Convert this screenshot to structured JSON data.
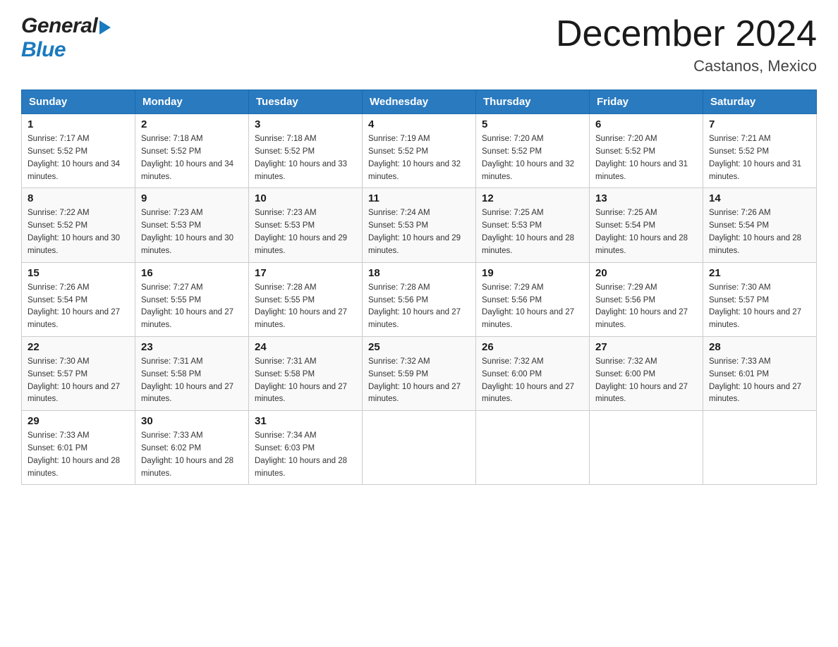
{
  "header": {
    "logo": {
      "general": "General",
      "blue": "Blue"
    },
    "title": "December 2024",
    "location": "Castanos, Mexico"
  },
  "calendar": {
    "days_of_week": [
      "Sunday",
      "Monday",
      "Tuesday",
      "Wednesday",
      "Thursday",
      "Friday",
      "Saturday"
    ],
    "weeks": [
      [
        {
          "day": "1",
          "sunrise": "7:17 AM",
          "sunset": "5:52 PM",
          "daylight": "10 hours and 34 minutes."
        },
        {
          "day": "2",
          "sunrise": "7:18 AM",
          "sunset": "5:52 PM",
          "daylight": "10 hours and 34 minutes."
        },
        {
          "day": "3",
          "sunrise": "7:18 AM",
          "sunset": "5:52 PM",
          "daylight": "10 hours and 33 minutes."
        },
        {
          "day": "4",
          "sunrise": "7:19 AM",
          "sunset": "5:52 PM",
          "daylight": "10 hours and 32 minutes."
        },
        {
          "day": "5",
          "sunrise": "7:20 AM",
          "sunset": "5:52 PM",
          "daylight": "10 hours and 32 minutes."
        },
        {
          "day": "6",
          "sunrise": "7:20 AM",
          "sunset": "5:52 PM",
          "daylight": "10 hours and 31 minutes."
        },
        {
          "day": "7",
          "sunrise": "7:21 AM",
          "sunset": "5:52 PM",
          "daylight": "10 hours and 31 minutes."
        }
      ],
      [
        {
          "day": "8",
          "sunrise": "7:22 AM",
          "sunset": "5:52 PM",
          "daylight": "10 hours and 30 minutes."
        },
        {
          "day": "9",
          "sunrise": "7:23 AM",
          "sunset": "5:53 PM",
          "daylight": "10 hours and 30 minutes."
        },
        {
          "day": "10",
          "sunrise": "7:23 AM",
          "sunset": "5:53 PM",
          "daylight": "10 hours and 29 minutes."
        },
        {
          "day": "11",
          "sunrise": "7:24 AM",
          "sunset": "5:53 PM",
          "daylight": "10 hours and 29 minutes."
        },
        {
          "day": "12",
          "sunrise": "7:25 AM",
          "sunset": "5:53 PM",
          "daylight": "10 hours and 28 minutes."
        },
        {
          "day": "13",
          "sunrise": "7:25 AM",
          "sunset": "5:54 PM",
          "daylight": "10 hours and 28 minutes."
        },
        {
          "day": "14",
          "sunrise": "7:26 AM",
          "sunset": "5:54 PM",
          "daylight": "10 hours and 28 minutes."
        }
      ],
      [
        {
          "day": "15",
          "sunrise": "7:26 AM",
          "sunset": "5:54 PM",
          "daylight": "10 hours and 27 minutes."
        },
        {
          "day": "16",
          "sunrise": "7:27 AM",
          "sunset": "5:55 PM",
          "daylight": "10 hours and 27 minutes."
        },
        {
          "day": "17",
          "sunrise": "7:28 AM",
          "sunset": "5:55 PM",
          "daylight": "10 hours and 27 minutes."
        },
        {
          "day": "18",
          "sunrise": "7:28 AM",
          "sunset": "5:56 PM",
          "daylight": "10 hours and 27 minutes."
        },
        {
          "day": "19",
          "sunrise": "7:29 AM",
          "sunset": "5:56 PM",
          "daylight": "10 hours and 27 minutes."
        },
        {
          "day": "20",
          "sunrise": "7:29 AM",
          "sunset": "5:56 PM",
          "daylight": "10 hours and 27 minutes."
        },
        {
          "day": "21",
          "sunrise": "7:30 AM",
          "sunset": "5:57 PM",
          "daylight": "10 hours and 27 minutes."
        }
      ],
      [
        {
          "day": "22",
          "sunrise": "7:30 AM",
          "sunset": "5:57 PM",
          "daylight": "10 hours and 27 minutes."
        },
        {
          "day": "23",
          "sunrise": "7:31 AM",
          "sunset": "5:58 PM",
          "daylight": "10 hours and 27 minutes."
        },
        {
          "day": "24",
          "sunrise": "7:31 AM",
          "sunset": "5:58 PM",
          "daylight": "10 hours and 27 minutes."
        },
        {
          "day": "25",
          "sunrise": "7:32 AM",
          "sunset": "5:59 PM",
          "daylight": "10 hours and 27 minutes."
        },
        {
          "day": "26",
          "sunrise": "7:32 AM",
          "sunset": "6:00 PM",
          "daylight": "10 hours and 27 minutes."
        },
        {
          "day": "27",
          "sunrise": "7:32 AM",
          "sunset": "6:00 PM",
          "daylight": "10 hours and 27 minutes."
        },
        {
          "day": "28",
          "sunrise": "7:33 AM",
          "sunset": "6:01 PM",
          "daylight": "10 hours and 27 minutes."
        }
      ],
      [
        {
          "day": "29",
          "sunrise": "7:33 AM",
          "sunset": "6:01 PM",
          "daylight": "10 hours and 28 minutes."
        },
        {
          "day": "30",
          "sunrise": "7:33 AM",
          "sunset": "6:02 PM",
          "daylight": "10 hours and 28 minutes."
        },
        {
          "day": "31",
          "sunrise": "7:34 AM",
          "sunset": "6:03 PM",
          "daylight": "10 hours and 28 minutes."
        },
        null,
        null,
        null,
        null
      ]
    ]
  }
}
